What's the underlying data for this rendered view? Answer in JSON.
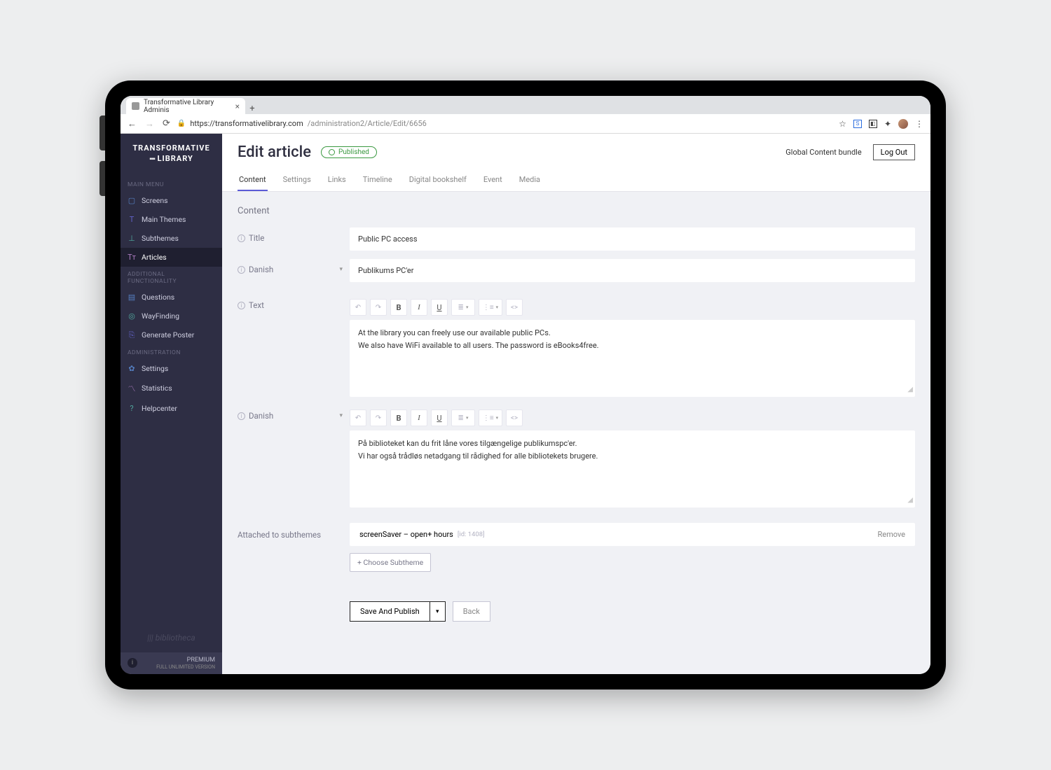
{
  "browser": {
    "tab_title": "Transformative Library Adminis",
    "url_host": "https://transformativelibrary.com",
    "url_path": "/administration2/Article/Edit/6656"
  },
  "brand": {
    "line1": "TRANSFORMATIVE",
    "line2": "LIBRARY"
  },
  "sidebar": {
    "sections": [
      {
        "title": "MAIN MENU",
        "items": [
          {
            "icon": "⌸",
            "label": "Screens"
          },
          {
            "icon": "T",
            "label": "Main Themes"
          },
          {
            "icon": "⏚",
            "label": "Subthemes"
          },
          {
            "icon": "Tт",
            "label": "Articles",
            "active": true
          }
        ]
      },
      {
        "title": "ADDITIONAL FUNCTIONALITY",
        "items": [
          {
            "icon": "▤",
            "label": "Questions"
          },
          {
            "icon": "◎",
            "label": "WayFinding"
          },
          {
            "icon": "⎘",
            "label": "Generate Poster"
          }
        ]
      },
      {
        "title": "ADMINISTRATION",
        "items": [
          {
            "icon": "✿",
            "label": "Settings"
          },
          {
            "icon": "〽",
            "label": "Statistics"
          },
          {
            "icon": "?",
            "label": "Helpcenter"
          }
        ]
      }
    ],
    "footer_brand": "||| bibliotheca",
    "premium_title": "PREMIUM",
    "premium_sub": "FULL UNLIMITED VERSION"
  },
  "header": {
    "title": "Edit article",
    "status": "Published",
    "bundle": "Global Content bundle",
    "logout": "Log Out",
    "tabs": [
      "Content",
      "Settings",
      "Links",
      "Timeline",
      "Digital bookshelf",
      "Event",
      "Media"
    ]
  },
  "content": {
    "section_label": "Content",
    "labels": {
      "title": "Title",
      "danish": "Danish",
      "text": "Text",
      "danish2": "Danish",
      "attached": "Attached to subthemes"
    },
    "title_value": "Public PC access",
    "danish_title_value": "Publikums PC'er",
    "text_lines": [
      "At the library you can freely use our available public PCs.",
      "We also have WiFi available to all users. The password is eBooks4free."
    ],
    "danish_text_lines": [
      "På biblioteket kan du frit låne vores tilgængelige publikumspc'er.",
      "Vi har også trådløs netadgang til rådighed for alle bibliotekets brugere."
    ],
    "subtheme": {
      "name": "screenSaver – open+ hours",
      "id_label": "[id: 1408]",
      "remove": "Remove"
    },
    "choose_subtheme": "+ Choose Subtheme",
    "save": "Save And Publish",
    "back": "Back"
  }
}
